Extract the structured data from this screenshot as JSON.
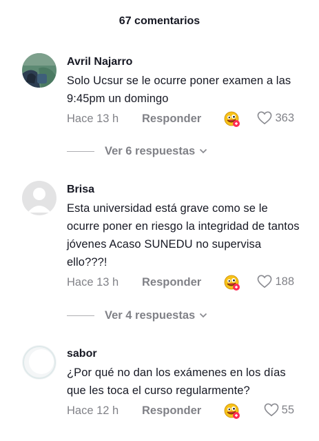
{
  "header": {
    "title": "67 comentarios"
  },
  "comments": [
    {
      "username": "Avril Najarro",
      "text": "Solo Ucsur se le ocurre poner examen a las 9:45pm un domingo",
      "time": "Hace 13 h",
      "reply_label": "Responder",
      "likes": "363",
      "replies_label": "Ver 6 respuestas"
    },
    {
      "username": "Brisa",
      "text": "Esta universidad está grave como se le ocurre poner en riesgo la integridad de tantos jóvenes Acaso SUNEDU no supervisa ello???!",
      "time": "Hace 13 h",
      "reply_label": "Responder",
      "likes": "188",
      "replies_label": "Ver 4 respuestas"
    },
    {
      "username": "sabor",
      "text": "¿Por qué no dan los exámenes en los días que les toca el curso regularmente?",
      "time": "Hace 12 h",
      "reply_label": "Responder",
      "likes": "55"
    }
  ],
  "colors": {
    "text": "#161823",
    "muted": "#8a8b91",
    "badge": "#fe2c55"
  },
  "icons": {
    "like": "heart-outline-icon",
    "reaction": "emoji-reaction-icon",
    "expand": "chevron-down-icon"
  }
}
